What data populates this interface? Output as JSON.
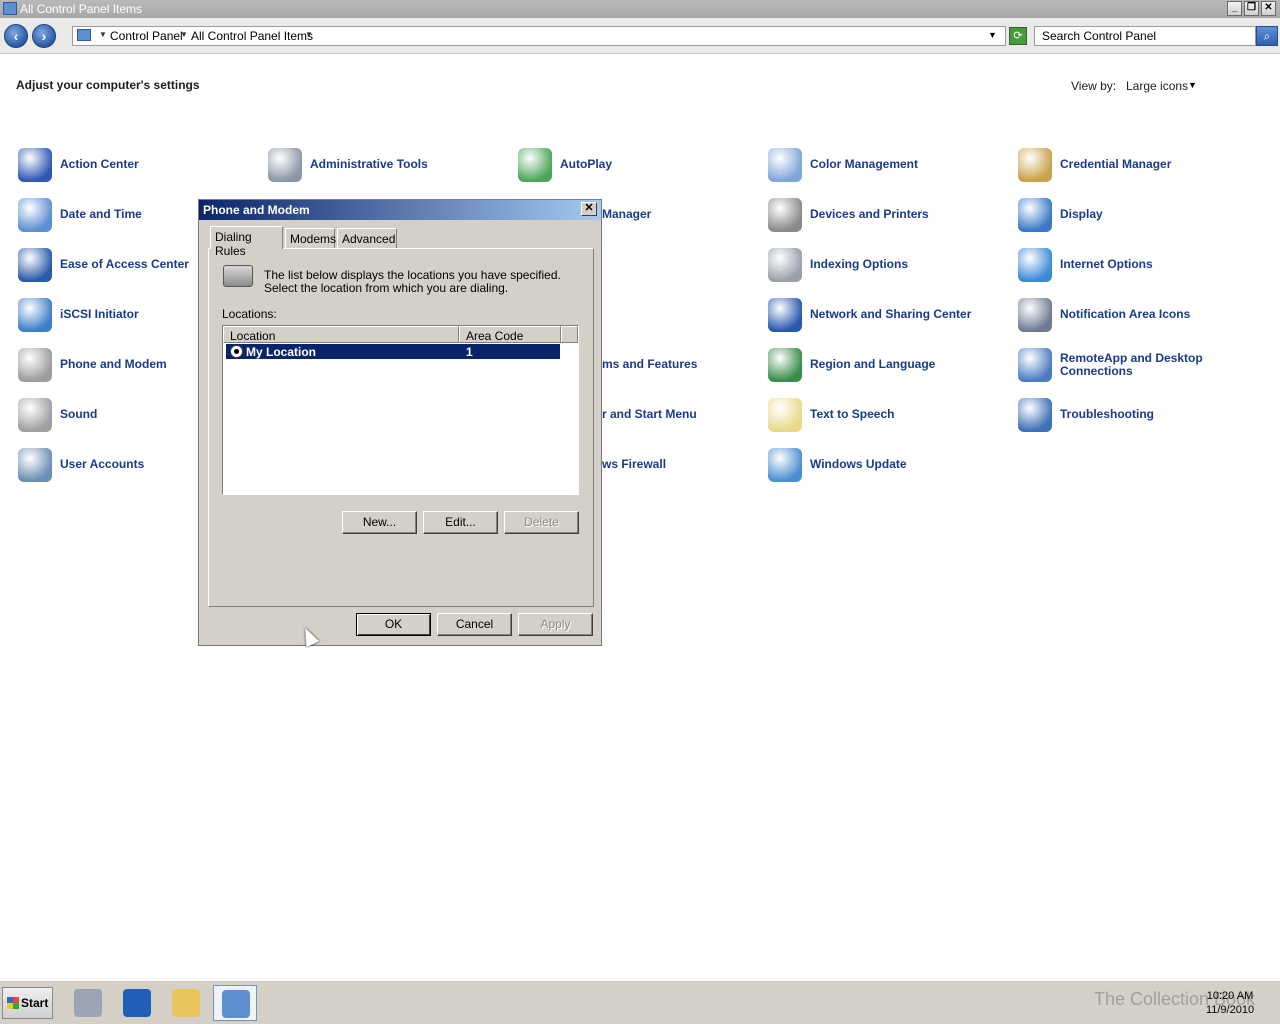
{
  "window": {
    "title": "All Control Panel Items",
    "minimize": "_",
    "restore": "❐",
    "close": "✕"
  },
  "address": {
    "back": "‹",
    "forward": "›",
    "crumbs": [
      "Control Panel",
      "All Control Panel Items"
    ],
    "search_placeholder": "Search Control Panel",
    "search_glyph": "⌕"
  },
  "header": {
    "heading": "Adjust your computer's settings",
    "view_by_label": "View by:",
    "view_by_value": "Large icons"
  },
  "items": [
    {
      "label": "Action Center",
      "color": "#2e58b5"
    },
    {
      "label": "Administrative Tools",
      "color": "#8a97a8"
    },
    {
      "label": "AutoPlay",
      "color": "#4ca65a"
    },
    {
      "label": "Color Management",
      "color": "#7ea6d8"
    },
    {
      "label": "Credential Manager",
      "color": "#c9a24a"
    },
    {
      "label": "Date and Time",
      "color": "#5b8fd1"
    },
    {
      "label": "Manager",
      "color": "#7a88a0"
    },
    {
      "label": "Devices and Printers",
      "color": "#8a8a8a"
    },
    {
      "label": "Display",
      "color": "#3a78c8"
    },
    {
      "label": "Ease of Access Center",
      "color": "#2a5ba8"
    },
    {
      "label": "Indexing Options",
      "color": "#9aa0aa"
    },
    {
      "label": "Internet Options",
      "color": "#3c8ad6"
    },
    {
      "label": "iSCSI Initiator",
      "color": "#3d7fc8"
    },
    {
      "label": "Network and Sharing Center",
      "color": "#2a58b0"
    },
    {
      "label": "Notification Area Icons",
      "color": "#6e7c92"
    },
    {
      "label": "Phone and Modem",
      "color": "#9c9c9c"
    },
    {
      "label": "ms and Features",
      "color": "#7a88a0"
    },
    {
      "label": "Region and Language",
      "color": "#3a8c4a"
    },
    {
      "label": "RemoteApp and Desktop Connections",
      "color": "#4d7cc4"
    },
    {
      "label": "Sound",
      "color": "#a0a0a0"
    },
    {
      "label": "r and Start Menu",
      "color": "#7a88a0"
    },
    {
      "label": "Text to Speech",
      "color": "#e8d98a"
    },
    {
      "label": "Troubleshooting",
      "color": "#3f6fb8"
    },
    {
      "label": "User Accounts",
      "color": "#6b8fb5"
    },
    {
      "label": "ws Firewall",
      "color": "#7a88a0"
    },
    {
      "label": "Windows Update",
      "color": "#4a90d0"
    }
  ],
  "dialog": {
    "title": "Phone and Modem",
    "close": "✕",
    "tabs": [
      "Dialing Rules",
      "Modems",
      "Advanced"
    ],
    "description": "The list below displays the locations you have specified. Select the location from which you are dialing.",
    "locations_label": "Locations:",
    "columns": [
      "Location",
      "Area Code"
    ],
    "rows": [
      {
        "location": "My Location",
        "area_code": "1"
      }
    ],
    "buttons": {
      "new": "New...",
      "edit": "Edit...",
      "delete": "Delete",
      "ok": "OK",
      "cancel": "Cancel",
      "apply": "Apply"
    }
  },
  "taskbar": {
    "start": "Start",
    "time": "10:20 AM",
    "date": "11/9/2010",
    "watermark": "The Collection Book"
  }
}
